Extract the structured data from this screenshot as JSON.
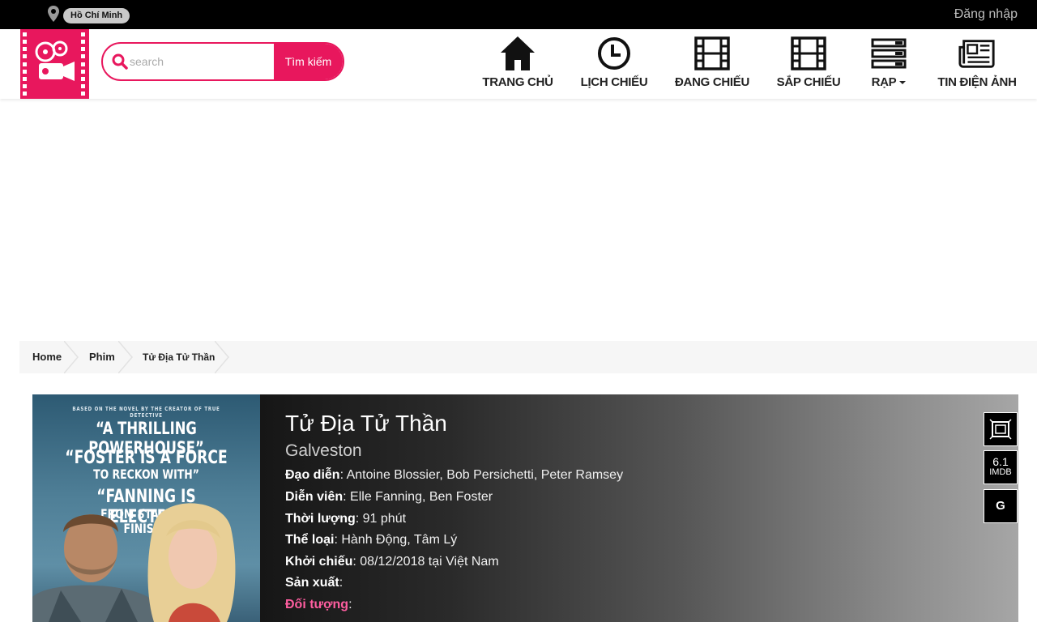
{
  "topbar": {
    "location": "Hồ Chí Minh",
    "login": "Đăng nhập"
  },
  "search": {
    "placeholder": "search",
    "button": "Tìm kiếm"
  },
  "nav": [
    {
      "label": "TRANG CHỦ",
      "icon": "home-icon"
    },
    {
      "label": "LỊCH CHIẾU",
      "icon": "clock-icon"
    },
    {
      "label": "ĐANG CHIẾU",
      "icon": "film-icon"
    },
    {
      "label": "SẮP CHIẾU",
      "icon": "film-strip-icon"
    },
    {
      "label": "RẠP",
      "icon": "list-icon"
    },
    {
      "label": "TIN ĐIỆN ẢNH",
      "icon": "newspaper-icon"
    }
  ],
  "breadcrumb": [
    "Home",
    "Phim",
    "Tử Địa Tử Thần"
  ],
  "movie": {
    "title_vi": "Tử Địa Tử Thần",
    "title_en": "Galveston",
    "fields": [
      {
        "label": "Đạo diễn",
        "value": "Antoine Blossier, Bob Persichetti, Peter Ramsey"
      },
      {
        "label": "Diễn viên",
        "value": "Elle Fanning, Ben Foster"
      },
      {
        "label": "Thời lượng",
        "value": "91 phút"
      },
      {
        "label": "Thể loại",
        "value": "Hành Động, Tâm Lý"
      },
      {
        "label": "Khởi chiếu",
        "value": "08/12/2018 tại Việt Nam"
      },
      {
        "label": "Sản xuất",
        "value": ""
      },
      {
        "label": "Đối tượng",
        "value": ""
      }
    ],
    "imdb_score": "6.1",
    "imdb_label": "IMDB",
    "rating": "G",
    "poster": {
      "tagline": "BASED ON THE NOVEL BY THE CREATOR OF TRUE DETECTIVE",
      "quote1": "“A THRILLING POWERHOUSE”",
      "quote2": "“FOSTER IS A FORCE",
      "quote2b": "TO RECKON WITH”",
      "quote3": "“FANNING IS ELECTRIC",
      "quote3b": "FROM START TO",
      "quote3c": "FINISH”"
    }
  },
  "colors": {
    "accent": "#e8175d",
    "topbar": "#000000",
    "target_label": "#ff5ea0"
  }
}
